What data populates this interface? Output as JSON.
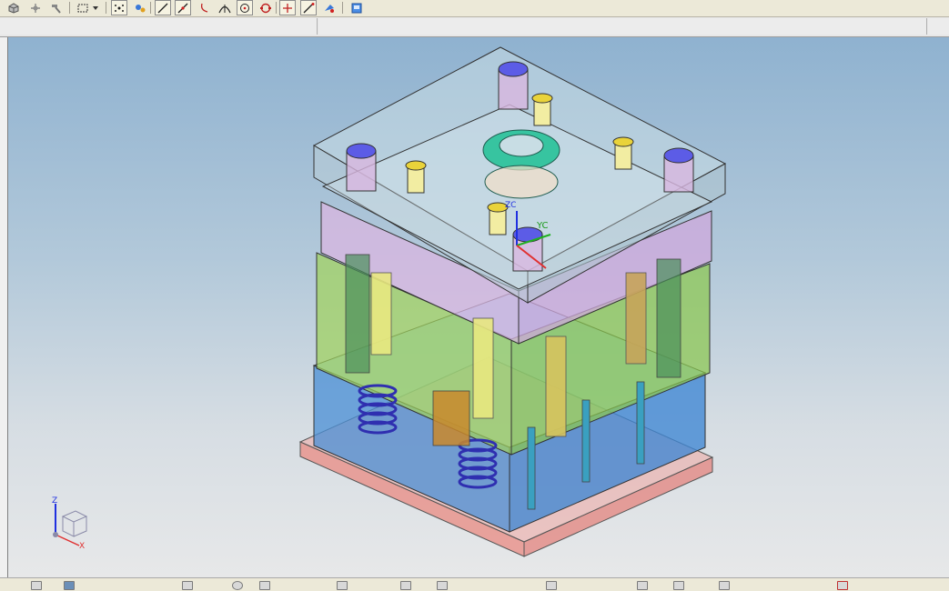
{
  "toolbar": {
    "buttons": [
      {
        "name": "cube-select-icon"
      },
      {
        "name": "point-snap-icon"
      },
      {
        "name": "hammer-icon"
      },
      {
        "name": "box-select-icon"
      },
      {
        "name": "dropdown-arrow-icon"
      },
      {
        "name": "snap-all-icon"
      },
      {
        "name": "snap-points-icon"
      },
      {
        "name": "line-icon"
      },
      {
        "name": "midpoint-line-icon"
      },
      {
        "name": "curve-icon"
      },
      {
        "name": "intersection-icon"
      },
      {
        "name": "arc-center-icon"
      },
      {
        "name": "quadrant-icon"
      },
      {
        "name": "existing-point-icon"
      },
      {
        "name": "endpoint-line-icon"
      },
      {
        "name": "point-on-face-icon"
      },
      {
        "name": "feature-box-icon"
      }
    ]
  },
  "viewport": {
    "wcs_labels": {
      "yc": "YC",
      "zc": "ZC"
    },
    "triad": {
      "z": "Z",
      "x": "X"
    },
    "colors": {
      "top_plate": "#c8dde4",
      "a_plate": "#d8b6e0",
      "b_plate": "#b6dd7a",
      "support_plate": "#5aa9e0",
      "clamp_plate": "#f0a7a3",
      "locating_ring": "#37c4a0",
      "springs": "#3b3bd0",
      "leader_pins": "#e8e880"
    }
  }
}
